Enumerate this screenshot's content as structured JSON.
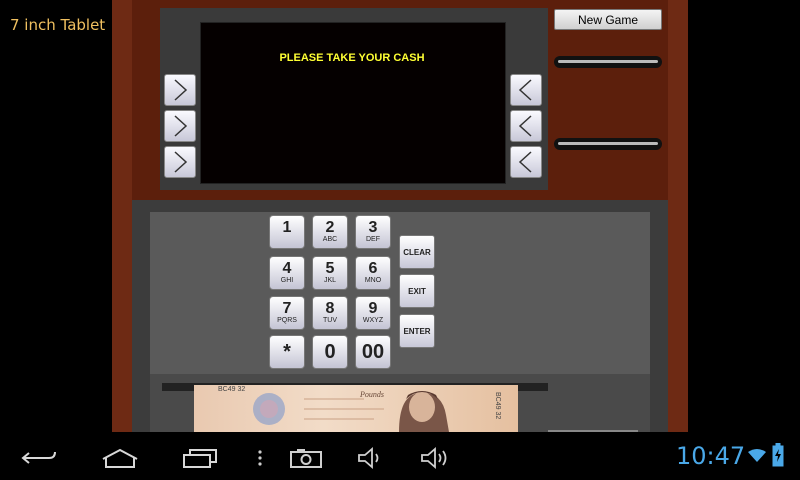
{
  "device_label": "7 inch Tablet",
  "atm": {
    "screen_message": "PLEASE TAKE YOUR CASH",
    "new_game_label": "New Game",
    "left_buttons": [
      "chevron-right-icon",
      "chevron-right-icon",
      "chevron-right-icon"
    ],
    "right_buttons": [
      "chevron-left-icon",
      "chevron-left-icon",
      "chevron-left-icon"
    ]
  },
  "keypad": {
    "keys": [
      {
        "num": "1",
        "sub": ""
      },
      {
        "num": "2",
        "sub": "ABC"
      },
      {
        "num": "3",
        "sub": "DEF"
      },
      {
        "num": "4",
        "sub": "GHI"
      },
      {
        "num": "5",
        "sub": "JKL"
      },
      {
        "num": "6",
        "sub": "MNO"
      },
      {
        "num": "7",
        "sub": "PQRS"
      },
      {
        "num": "8",
        "sub": "TUV"
      },
      {
        "num": "9",
        "sub": "WXYZ"
      },
      {
        "num": "*",
        "sub": ""
      },
      {
        "num": "0",
        "sub": ""
      },
      {
        "num": "00",
        "sub": ""
      }
    ],
    "clear_label": "CLEAR",
    "exit_label": "EXIT",
    "enter_label": "ENTER"
  },
  "banknote": {
    "serial_left": "BC49 32",
    "pounds_text": "Pounds",
    "serial_right": "BC49 32"
  },
  "system_bar": {
    "time": "10:47",
    "icons": [
      "back-icon",
      "home-icon",
      "recent-apps-icon",
      "menu-icon",
      "camera-icon",
      "volume-down-icon",
      "volume-up-icon",
      "wifi-icon",
      "battery-icon"
    ],
    "accent_color": "#4aa8e8"
  }
}
